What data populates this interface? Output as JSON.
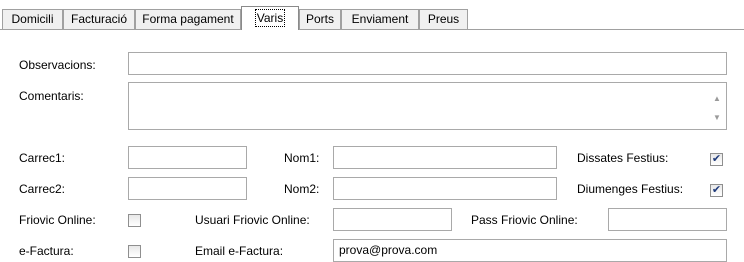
{
  "tabs": [
    {
      "label": "Domicili",
      "active": false
    },
    {
      "label": "Facturació",
      "active": false
    },
    {
      "label": "Forma pagament",
      "active": false
    },
    {
      "label": "Varis",
      "active": true
    },
    {
      "label": "Ports",
      "active": false
    },
    {
      "label": "Enviament",
      "active": false
    },
    {
      "label": "Preus",
      "active": false
    }
  ],
  "fields": {
    "observacions": {
      "label": "Observacions:",
      "value": ""
    },
    "comentaris": {
      "label": "Comentaris:",
      "value": ""
    },
    "carrec1": {
      "label": "Carrec1:",
      "value": ""
    },
    "nom1": {
      "label": "Nom1:",
      "value": ""
    },
    "carrec2": {
      "label": "Carrec2:",
      "value": ""
    },
    "nom2": {
      "label": "Nom2:",
      "value": ""
    },
    "usuari_friovic_online": {
      "label": "Usuari Friovic Online:",
      "value": ""
    },
    "pass_friovic_online": {
      "label": "Pass Friovic Online:",
      "value": ""
    },
    "email_efactura": {
      "label": "Email e-Factura:",
      "value": "prova@prova.com"
    }
  },
  "checkboxes": {
    "dissates_festius": {
      "label": "Dissates Festius:",
      "checked": true
    },
    "diumenges_festius": {
      "label": "Diumenges Festius:",
      "checked": true
    },
    "friovic_online": {
      "label": "Friovic Online:",
      "checked": false
    },
    "efactura": {
      "label": "e-Factura:",
      "checked": false
    }
  },
  "icons": {
    "check": "✔",
    "scroll_up": "▲",
    "scroll_down": "▼"
  }
}
